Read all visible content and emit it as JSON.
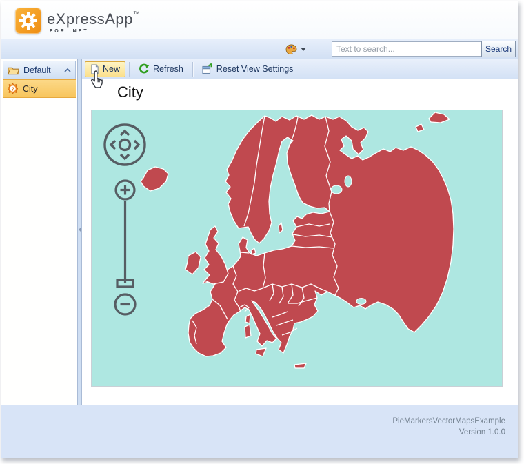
{
  "header": {
    "brand": {
      "name": "eXpressApp",
      "tm": "™",
      "subtitle": "FOR .NET"
    },
    "theme_picker": {
      "icon": "palette-icon"
    },
    "search": {
      "placeholder": "Text to search...",
      "button_label": "Search"
    }
  },
  "sidebar": {
    "groups": [
      {
        "label": "Default",
        "icon": "folder-icon",
        "collapsed": false,
        "items": [
          {
            "label": "City",
            "icon": "model-gear-icon",
            "selected": true
          }
        ]
      }
    ]
  },
  "toolbar": {
    "buttons": [
      {
        "label": "New",
        "icon": "new-document-icon",
        "hovered": true
      },
      {
        "label": "Refresh",
        "icon": "refresh-icon",
        "hovered": false
      },
      {
        "label": "Reset View Settings",
        "icon": "reset-view-icon",
        "hovered": false
      }
    ]
  },
  "main": {
    "title": "City"
  },
  "map": {
    "type": "vector-map",
    "region": "Europe",
    "sea_color": "#aee7e1",
    "land_color": "#c0494f",
    "border_color": "#ffffff",
    "control_color": "#565d63",
    "controls": [
      "pan",
      "zoom-in",
      "zoom-slider",
      "zoom-out"
    ]
  },
  "footer": {
    "line1": "PieMarkersVectorMapsExample",
    "line2": "Version 1.0.0"
  }
}
